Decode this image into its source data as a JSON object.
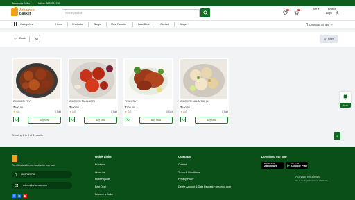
{
  "topbar": {
    "seller": "Become a Seller",
    "hotline": "Hotline: 8637821786"
  },
  "logo": {
    "line1": "Arhamco",
    "line2": "Basket"
  },
  "search": {
    "placeholder": "Search product"
  },
  "header": {
    "currency": "INR ₹",
    "language": "English",
    "login": "Login",
    "wishlist_count": "0",
    "cart_count": "0"
  },
  "nav": {
    "categories": "Categories",
    "links": [
      "Home",
      "Products",
      "Shops",
      "Most Popular",
      "Best Deal",
      "Contact",
      "Blogs"
    ],
    "download": "Download our app"
  },
  "filterbar": {
    "back": "Back",
    "all": "All",
    "filter": "Filter"
  },
  "products": [
    {
      "name": "CHICKEN FRY",
      "price": "₹100.00",
      "rating": "0.0",
      "sold": "0 Sold",
      "buy": "Buy Now"
    },
    {
      "name": "CHICKEN TANDOORI",
      "price": "₹100.00",
      "rating": "0.0",
      "sold": "0 Sold",
      "buy": "Buy Now"
    },
    {
      "name": "FISH FRY",
      "price": "₹120.00",
      "rating": "0.0",
      "sold": "0 Sold",
      "buy": "Buy Now"
    },
    {
      "name": "CHICKEN MALAI TIKKA",
      "price": "₹160.00",
      "rating": "0.0",
      "sold": "0 Sold",
      "buy": "Buy Now"
    }
  ],
  "pagination": {
    "showing": "Showing 1 to 4 of 4 results",
    "current_page": "1"
  },
  "floating_cart": {
    "count": "0",
    "price": "₹0.00"
  },
  "footer": {
    "tagline": "The ultimate all-in-one solution for your need",
    "phone": "8637821786",
    "email": "admin@arhamco.com",
    "quick_links": {
      "title": "Quick Links",
      "items": [
        "Products",
        "About us",
        "Most Popular",
        "Best Deal",
        "Become a Seller"
      ]
    },
    "company": {
      "title": "Company",
      "items": [
        "Contact",
        "Terms & Conditions",
        "Privacy Policy",
        "Delete Account & Data Request ~Arhamco.com"
      ]
    },
    "download": {
      "title": "Download our app",
      "appstore_small": "Available on the",
      "appstore": "App Store",
      "googleplay_small": "GET IT ON",
      "googleplay": "Google Play"
    },
    "activate": {
      "title": "Activate Windows",
      "subtitle": "Go to Settings to activate Windows."
    }
  },
  "colors": {
    "brand_green": "#0f6a22",
    "footer_green": "#0a4f17",
    "accent_orange": "#f2a31b"
  }
}
